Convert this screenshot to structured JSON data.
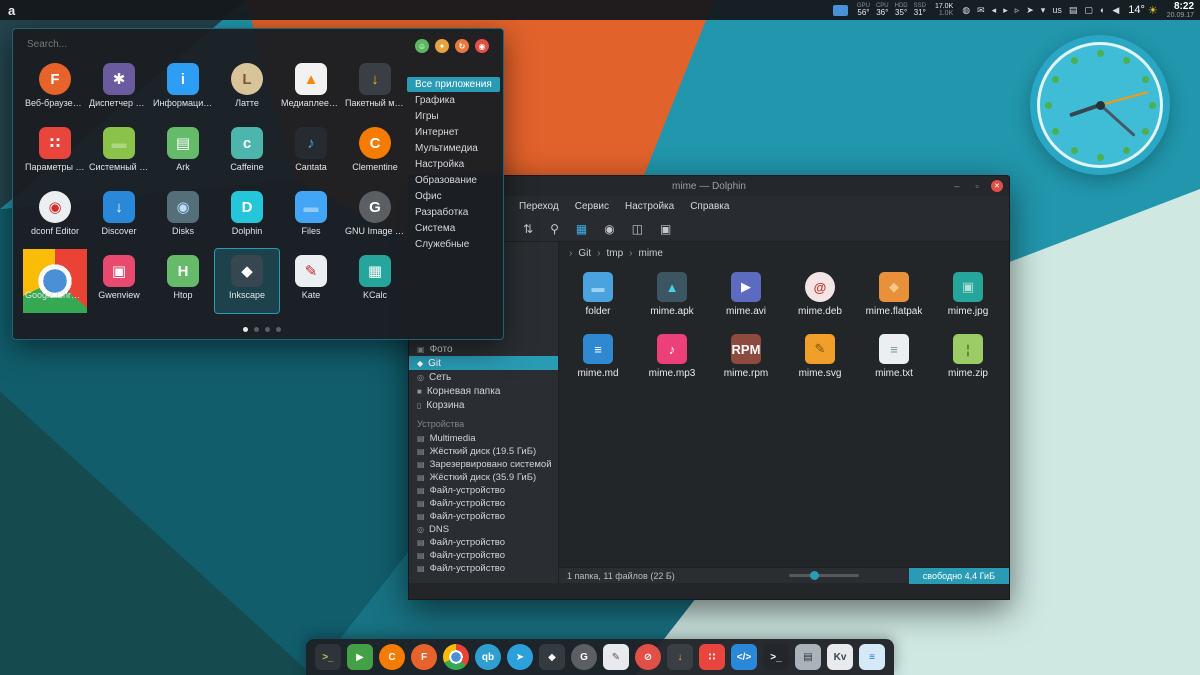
{
  "colors": {
    "accent": "#2a9bb5",
    "panel_bg": "#15181c",
    "window_bg": "#232629",
    "wallpaper_orange": "#e2622b"
  },
  "panel": {
    "logo": "a",
    "monitors": [
      {
        "label": "GPU",
        "value": "56°"
      },
      {
        "label": "CPU",
        "value": "36°"
      },
      {
        "label": "HDD",
        "value": "35°"
      },
      {
        "label": "SSD",
        "value": "31°"
      }
    ],
    "net": {
      "up": "17.0K",
      "down": "1.0K"
    },
    "tray": [
      {
        "name": "rss-icon",
        "glyph": "◍"
      },
      {
        "name": "mail-icon",
        "glyph": "✉"
      },
      {
        "name": "media-prev-icon",
        "glyph": "◂"
      },
      {
        "name": "media-play-icon",
        "glyph": "▸"
      },
      {
        "name": "media-next-icon",
        "glyph": "▹"
      },
      {
        "name": "network-send-icon",
        "glyph": "➤"
      },
      {
        "name": "notifications-icon",
        "glyph": "▾"
      },
      {
        "name": "keyboard-layout-indicator",
        "glyph": "us"
      },
      {
        "name": "clipboard-icon",
        "glyph": "▤"
      },
      {
        "name": "display-icon",
        "glyph": "▢"
      },
      {
        "name": "color-profile-icon",
        "glyph": "◐"
      },
      {
        "name": "volume-icon",
        "glyph": "◀"
      }
    ],
    "weather": {
      "temp": "14°",
      "icon": "☀"
    },
    "clock": {
      "time": "8:22",
      "date": "20.09.17"
    }
  },
  "launcher": {
    "search_placeholder": "Search...",
    "session_buttons": [
      {
        "name": "user-session-button",
        "color": "#5cb860",
        "glyph": "☺"
      },
      {
        "name": "lock-button",
        "color": "#e6a23c",
        "glyph": "✦"
      },
      {
        "name": "restart-button",
        "color": "#e8793a",
        "glyph": "↻"
      },
      {
        "name": "shutdown-button",
        "color": "#e05046",
        "glyph": "◉"
      }
    ],
    "categories": [
      {
        "label": "Все приложения",
        "selected": true
      },
      {
        "label": "Графика"
      },
      {
        "label": "Игры"
      },
      {
        "label": "Интернет"
      },
      {
        "label": "Мультимедиа"
      },
      {
        "label": "Настройка"
      },
      {
        "label": "Образование"
      },
      {
        "label": "Офис"
      },
      {
        "label": "Разработка"
      },
      {
        "label": "Система"
      },
      {
        "label": "Служебные"
      }
    ],
    "apps": [
      {
        "label": "Веб-браузер …",
        "color": "#e8632c",
        "glyph": "F",
        "radius": "50%"
      },
      {
        "label": "Диспетчер ра…",
        "color": "#6a5a9e",
        "glyph": "✱"
      },
      {
        "label": "Информация …",
        "color": "#2e9df4",
        "glyph": "i"
      },
      {
        "label": "Латте",
        "color": "#d9c49a",
        "glyph": "L",
        "glyphColor": "#7a5b33",
        "radius": "50%"
      },
      {
        "label": "Медиаплеер …",
        "color": "#f2f2f2",
        "glyph": "▲",
        "glyphColor": "#ff8800"
      },
      {
        "label": "Пакетный ме…",
        "color": "#3a3f45",
        "glyph": "↓",
        "glyphColor": "#ffb300"
      },
      {
        "label": "Параметры с…",
        "color": "#e8453c",
        "glyph": "∷"
      },
      {
        "label": "Системный м…",
        "color": "#8bc34a",
        "glyph": "▬",
        "glyphColor": "#aed581"
      },
      {
        "label": "Ark",
        "color": "#66bb6a",
        "glyph": "▤"
      },
      {
        "label": "Caffeine",
        "color": "#4db6ac",
        "glyph": "c"
      },
      {
        "label": "Cantata",
        "color": "#262b30",
        "glyph": "♪",
        "glyphColor": "#42a5f5"
      },
      {
        "label": "Clementine",
        "color": "#f57c00",
        "glyph": "C",
        "radius": "50%"
      },
      {
        "label": "dconf Editor",
        "color": "#eceff1",
        "glyph": "◉",
        "glyphColor": "#d32f2f",
        "radius": "50%"
      },
      {
        "label": "Discover",
        "color": "#2a88d8",
        "glyph": "↓"
      },
      {
        "label": "Disks",
        "color": "#546e7a",
        "glyph": "◉",
        "glyphColor": "#bbdefb"
      },
      {
        "label": "Dolphin",
        "color": "#26c6da",
        "glyph": "D"
      },
      {
        "label": "Files",
        "color": "#42a5f5",
        "glyph": "▬",
        "glyphColor": "#90caf9"
      },
      {
        "label": "GNU Image M…",
        "color": "#5b5f63",
        "glyph": "G",
        "radius": "50%"
      },
      {
        "label": "Google Chrome",
        "glyph": "",
        "cls": "chrome-icon",
        "radius": "50%"
      },
      {
        "label": "Gwenview",
        "color": "#e84a6f",
        "glyph": "▣"
      },
      {
        "label": "Htop",
        "color": "#66bb6a",
        "glyph": "H"
      },
      {
        "label": "Inkscape",
        "color": "#37474f",
        "glyph": "◆",
        "selected": true
      },
      {
        "label": "Kate",
        "color": "#eceff1",
        "glyph": "✎",
        "glyphColor": "#c62828"
      },
      {
        "label": "KCalc",
        "color": "#26a69a",
        "glyph": "▦"
      }
    ],
    "page_dots": [
      {
        "active": true
      },
      {
        "active": false
      },
      {
        "active": false
      },
      {
        "active": false
      }
    ]
  },
  "dolphin": {
    "title": "mime — Dolphin",
    "window_buttons": [
      {
        "name": "minimize-button",
        "glyph": "–"
      },
      {
        "name": "maximize-button",
        "glyph": "▫"
      },
      {
        "name": "close-button",
        "glyph": "✕",
        "cls": "close"
      }
    ],
    "menu": [
      "Переход",
      "Сервис",
      "Настройка",
      "Справка"
    ],
    "toolbar": [
      {
        "name": "sort-icon",
        "glyph": "⇅"
      },
      {
        "name": "search-icon",
        "glyph": "⚲"
      },
      {
        "name": "icons-view-icon",
        "glyph": "▦",
        "active": true
      },
      {
        "name": "preview-icon",
        "glyph": "◉"
      },
      {
        "name": "split-view-icon",
        "glyph": "◫"
      },
      {
        "name": "terminal-panel-icon",
        "glyph": "▣"
      }
    ],
    "breadcrumb": [
      "Git",
      "tmp",
      "mime"
    ],
    "places": [
      {
        "label": "Фото",
        "glyph": "▣"
      },
      {
        "label": "Git",
        "glyph": "◆",
        "selected": true
      },
      {
        "label": "Сеть",
        "glyph": "◎"
      },
      {
        "label": "Корневая папка",
        "glyph": "■"
      },
      {
        "label": "Корзина",
        "glyph": "▯"
      }
    ],
    "devices_header": "Устройства",
    "devices": [
      {
        "label": "Multimedia",
        "glyph": "▤"
      },
      {
        "label": "Жёсткий диск (19.5 ГиБ)",
        "glyph": "▤"
      },
      {
        "label": "Зарезервировано системой",
        "glyph": "▤"
      },
      {
        "label": "Жёсткий диск (35.9 ГиБ)",
        "glyph": "▤"
      },
      {
        "label": "Файл-устройство",
        "glyph": "▤"
      },
      {
        "label": "Файл-устройство",
        "glyph": "▤"
      },
      {
        "label": "Файл-устройство",
        "glyph": "▤"
      },
      {
        "label": "DNS",
        "glyph": "◎"
      },
      {
        "label": "Файл-устройство",
        "glyph": "▤"
      },
      {
        "label": "Файл-устройство",
        "glyph": "▤"
      },
      {
        "label": "Файл-устройство",
        "glyph": "▤"
      }
    ],
    "files": [
      {
        "label": "folder",
        "color": "#4aa3df",
        "glyph": "▬",
        "glyphColor": "#9fd1f2"
      },
      {
        "label": "mime.apk",
        "color": "#3b5562",
        "glyph": "▲",
        "glyphColor": "#4dd0e1"
      },
      {
        "label": "mime.avi",
        "color": "#5c6bc0",
        "glyph": "▶"
      },
      {
        "label": "mime.deb",
        "color": "#f3e5e5",
        "glyph": "@",
        "glyphColor": "#c0392b",
        "radius": "50%"
      },
      {
        "label": "mime.flatpak",
        "color": "#e8913a",
        "glyph": "◆",
        "glyphColor": "#f7c68a"
      },
      {
        "label": "mime.jpg",
        "color": "#26a69a",
        "glyph": "▣",
        "glyphColor": "#b2dfdb"
      },
      {
        "label": "mime.md",
        "color": "#2f88d0",
        "glyph": "≡"
      },
      {
        "label": "mime.mp3",
        "color": "#ec407a",
        "glyph": "♪"
      },
      {
        "label": "mime.rpm",
        "color": "#8d4a3f",
        "glyph": "RPM"
      },
      {
        "label": "mime.svg",
        "color": "#f0a02a",
        "glyph": "✎",
        "glyphColor": "#7a5210"
      },
      {
        "label": "mime.txt",
        "color": "#eceff1",
        "glyph": "≡",
        "glyphColor": "#78909c"
      },
      {
        "label": "mime.zip",
        "color": "#9ccc65",
        "glyph": "¦",
        "glyphColor": "#5a7d33"
      }
    ],
    "status": {
      "items": "1 папка, 11 файлов (22 Б)",
      "free": "свободно 4,4 ГиБ"
    }
  },
  "dock": {
    "items": [
      {
        "name": "terminal-icon",
        "color": "#2f343a",
        "glyph": ">_",
        "glyphColor": "#9fd356"
      },
      {
        "name": "media-player-icon",
        "color": "#43a047",
        "glyph": "▶"
      },
      {
        "name": "clementine-icon",
        "color": "#f57c00",
        "glyph": "C",
        "radius": "50%"
      },
      {
        "name": "firefox-icon",
        "color": "#e8632c",
        "glyph": "F",
        "radius": "50%"
      },
      {
        "name": "chrome-icon",
        "glyph": "",
        "cls": "chrome-icon",
        "radius": "50%"
      },
      {
        "name": "qbittorrent-icon",
        "color": "#2e9fd0",
        "glyph": "qb",
        "radius": "50%"
      },
      {
        "name": "telegram-icon",
        "color": "#2ba0da",
        "glyph": "➤",
        "radius": "50%"
      },
      {
        "name": "inkscape-icon",
        "color": "#333a40",
        "glyph": "◆"
      },
      {
        "name": "gimp-icon",
        "color": "#5b5f63",
        "glyph": "G",
        "radius": "50%"
      },
      {
        "name": "color-picker-icon",
        "color": "#e8eaed",
        "glyph": "✎",
        "glyphColor": "#555b61"
      },
      {
        "name": "blocked-app-icon",
        "color": "#e05046",
        "glyph": "⊘",
        "radius": "50%"
      },
      {
        "name": "package-manager-icon",
        "color": "#3a3f45",
        "glyph": "↓",
        "glyphColor": "#ffb300"
      },
      {
        "name": "tweaks-icon",
        "color": "#e8453c",
        "glyph": "∷"
      },
      {
        "name": "code-editor-icon",
        "color": "#2b87d8",
        "glyph": "</>"
      },
      {
        "name": "terminal-2-icon",
        "color": "#23272b",
        "glyph": ">_"
      },
      {
        "name": "archive-icon",
        "color": "#aab2ba",
        "glyph": "▤",
        "glyphColor": "#2f3337"
      },
      {
        "name": "kvantum-icon",
        "color": "#e8eaed",
        "glyph": "Kv",
        "glyphColor": "#37474f"
      },
      {
        "name": "task-list-icon",
        "color": "#d6e9f8",
        "glyph": "≡",
        "glyphColor": "#1976d2"
      }
    ]
  }
}
